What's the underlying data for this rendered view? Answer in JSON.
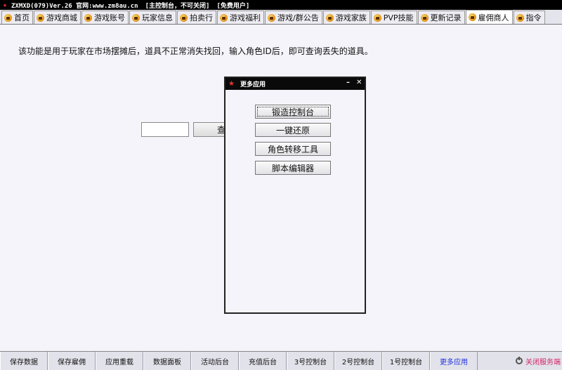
{
  "window": {
    "title": "ZXMXD(079)Ver.26 官网:www.zm8au.cn",
    "status1": "[主控制台，不可关闭]",
    "status2": "[免费用户]"
  },
  "tabs": [
    {
      "label": "首页"
    },
    {
      "label": "游戏商城"
    },
    {
      "label": "游戏账号"
    },
    {
      "label": "玩家信息"
    },
    {
      "label": "拍卖行"
    },
    {
      "label": "游戏福利"
    },
    {
      "label": "游戏/群公告"
    },
    {
      "label": "游戏家族"
    },
    {
      "label": "PVP技能"
    },
    {
      "label": "更新记录"
    },
    {
      "label": "雇佣商人",
      "active": true
    },
    {
      "label": "指令"
    }
  ],
  "main": {
    "description": "该功能是用于玩家在市场摆摊后，道具不正常消失找回，输入角色ID后，即可查询丢失的道具。",
    "id_input_value": "",
    "query_label": "查"
  },
  "dialog": {
    "title": "更多应用",
    "minimize": "–",
    "close": "✕",
    "buttons": [
      {
        "label": "锻造控制台"
      },
      {
        "label": "一键还原"
      },
      {
        "label": "角色转移工具"
      },
      {
        "label": "脚本编辑器"
      }
    ]
  },
  "bottom": {
    "buttons": [
      {
        "label": "保存数据"
      },
      {
        "label": "保存雇佣"
      },
      {
        "label": "应用重载"
      },
      {
        "label": "数据面板"
      },
      {
        "label": "活动后台"
      },
      {
        "label": "充值后台"
      },
      {
        "label": "3号控制台"
      },
      {
        "label": "2号控制台"
      },
      {
        "label": "1号控制台"
      },
      {
        "label": "更多应用",
        "highlight": true
      }
    ],
    "close_service": "关闭服务端"
  },
  "colors": {
    "accent_pink": "#d2246a",
    "highlight_blue": "#2233dd",
    "titlebar_bg": "#000000"
  }
}
